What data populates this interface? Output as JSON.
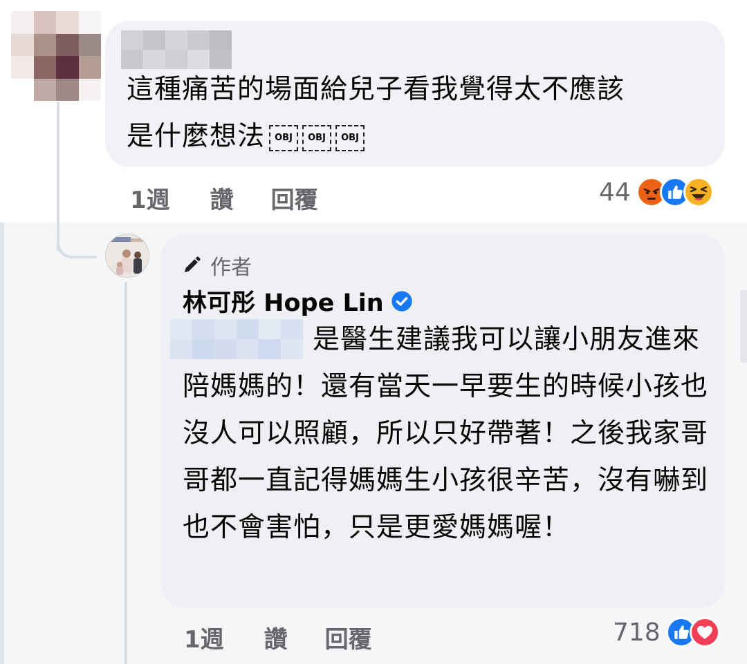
{
  "comment": {
    "text_line1": "這種痛苦的場面給兒子看我覺得太不應該",
    "text_line2": "是什麼想法",
    "obj_glyph": "OBJ",
    "time": "1週",
    "like_label": "讚",
    "reply_label": "回覆",
    "reaction_count": "44",
    "reaction_icons": [
      "angry-icon",
      "like-icon",
      "haha-icon"
    ]
  },
  "reply": {
    "author_badge": "作者",
    "author_name": "林可彤 Hope Lin",
    "verified_icon": "verified-badge-icon",
    "text": "是醫生建議我可以讓小朋友進來陪媽媽的！還有當天一早要生的時候小孩也沒人可以照顧，所以只好帶著！之後我家哥哥都一直記得媽媽生小孩很辛苦，沒有嚇到也不會害怕，只是更愛媽媽喔！",
    "time": "1週",
    "like_label": "讚",
    "reply_label": "回覆",
    "reaction_count": "718",
    "reaction_icons": [
      "like-icon",
      "love-icon"
    ]
  },
  "colors": {
    "like_blue": "#1877f2",
    "love_red": "#f33e58",
    "angry_orange": "#e9710f",
    "haha_yellow": "#f7b125",
    "verified_blue": "#1877f2",
    "muted_text": "#65676b"
  }
}
